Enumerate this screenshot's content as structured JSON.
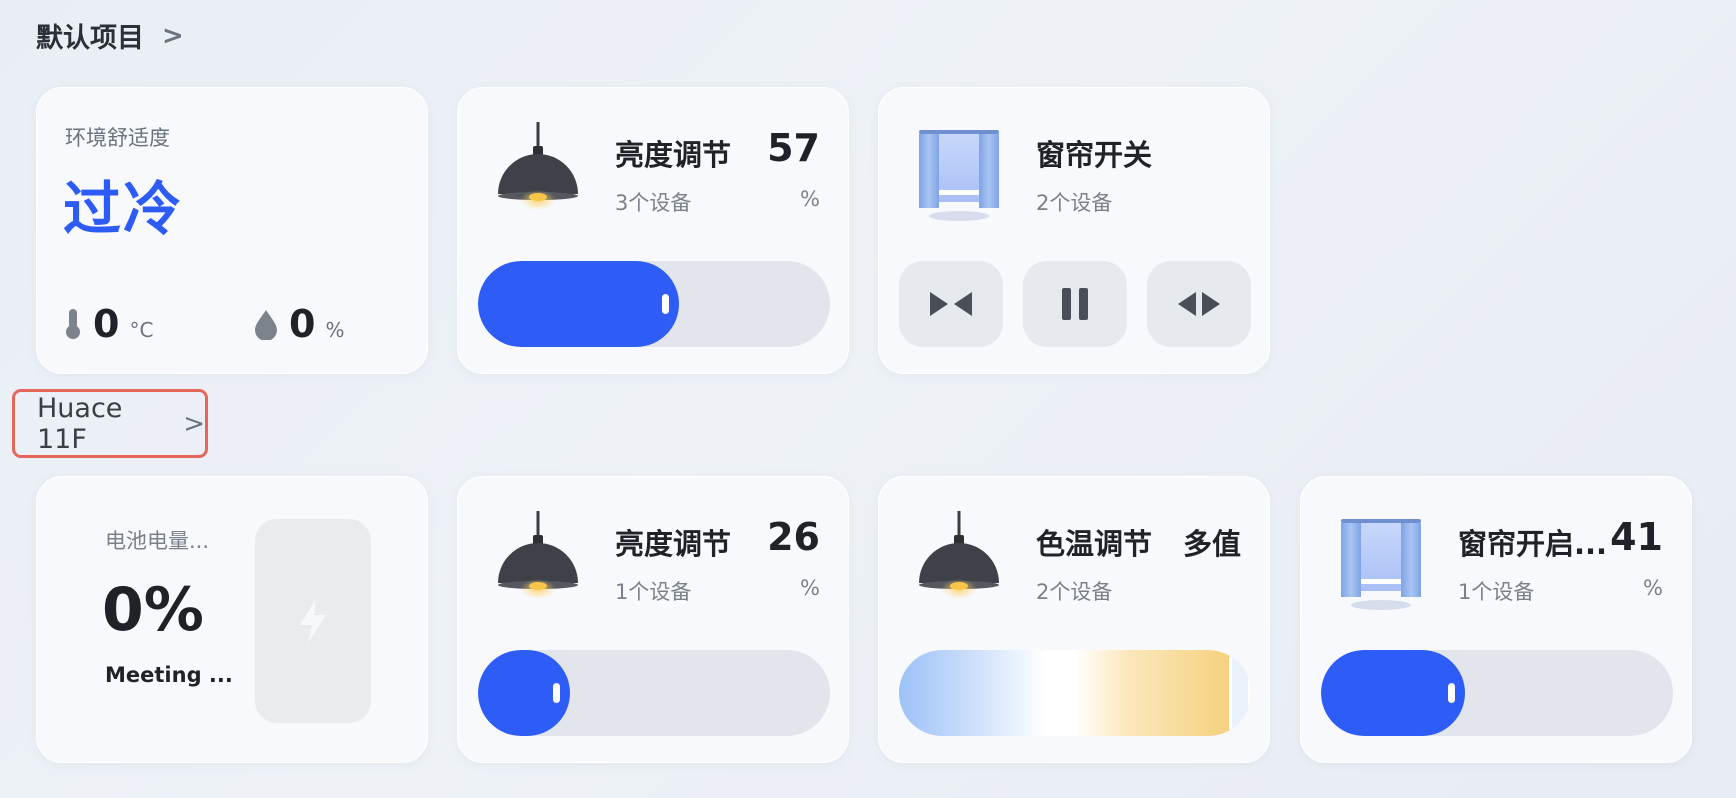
{
  "sections": [
    {
      "title": "默认项目"
    },
    {
      "title": "Huace 11F"
    }
  ],
  "comfort": {
    "label": "环境舒适度",
    "value": "过冷",
    "temperature": "0",
    "temperature_unit": "°C",
    "humidity": "0",
    "humidity_unit": "%"
  },
  "brightness1": {
    "name": "亮度调节",
    "count": "3个设备",
    "value": "57",
    "unit": "%",
    "level": 57
  },
  "curtain1": {
    "name": "窗帘开关",
    "count": "2个设备"
  },
  "battery": {
    "label": "电池电量...",
    "value": "0%",
    "device": "Meeting ..."
  },
  "brightness2": {
    "name": "亮度调节",
    "count": "1个设备",
    "value": "26",
    "unit": "%",
    "level": 26
  },
  "color_temp": {
    "name": "色温调节",
    "count": "2个设备",
    "value": "多值"
  },
  "curtain2": {
    "name": "窗帘开启...",
    "count": "1个设备",
    "value": "41",
    "unit": "%",
    "level": 41
  },
  "colors": {
    "accent": "#2d5cf6",
    "alert_border": "#e5675b"
  }
}
